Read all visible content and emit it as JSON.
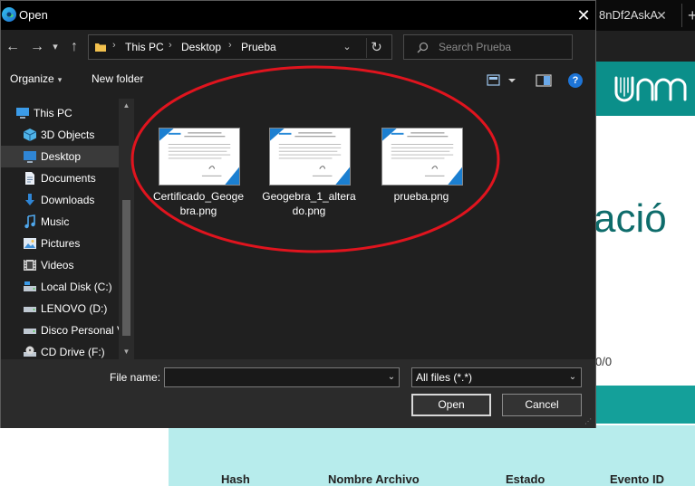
{
  "background": {
    "tab_title": "8nDf2AskA",
    "tab_close": "✕",
    "new_tab": "+",
    "heading_fragment": "ació",
    "pager_text": "0/0",
    "table_headers": [
      "Hash",
      "Nombre Archivo",
      "Estado",
      "Evento ID"
    ],
    "colors": {
      "header_teal": "#0b8f8a",
      "table_bg": "#b7ecec"
    }
  },
  "dialog": {
    "title": "Open",
    "close_glyph": "✕",
    "nav": {
      "back": "←",
      "forward": "→",
      "recent": "▾",
      "up": "↑"
    },
    "breadcrumb": [
      "This PC",
      "Desktop",
      "Prueba"
    ],
    "breadcrumb_sep": "›",
    "address_dropdown": "⌄",
    "refresh": "↻",
    "search_placeholder": "Search Prueba",
    "toolbar": {
      "organize": "Organize",
      "organize_caret": "▾",
      "new_folder": "New folder",
      "help": "?"
    },
    "nav_items": [
      {
        "label": "This PC",
        "icon": "computer-icon"
      },
      {
        "label": "3D Objects",
        "icon": "cube-icon"
      },
      {
        "label": "Desktop",
        "icon": "desktop-icon",
        "selected": true
      },
      {
        "label": "Documents",
        "icon": "document-icon"
      },
      {
        "label": "Downloads",
        "icon": "download-icon"
      },
      {
        "label": "Music",
        "icon": "music-icon"
      },
      {
        "label": "Pictures",
        "icon": "pictures-icon"
      },
      {
        "label": "Videos",
        "icon": "video-icon"
      },
      {
        "label": "Local Disk (C:)",
        "icon": "drive-icon"
      },
      {
        "label": "LENOVO (D:)",
        "icon": "drive-icon"
      },
      {
        "label": "Disco Personal V",
        "icon": "drive-icon"
      },
      {
        "label": "CD Drive (F:)",
        "icon": "cd-drive-icon"
      }
    ],
    "files": [
      {
        "name": "Certificado_Geogebra.png"
      },
      {
        "name": "Geogebra_1_alterado.png"
      },
      {
        "name": "prueba.png"
      }
    ],
    "file_name_label": "File name:",
    "file_name_value": "",
    "filter_value": "All files (*.*)",
    "dropdown_glyph": "⌄",
    "open_button": "Open",
    "cancel_button": "Cancel",
    "annotation_color": "#e0141e"
  }
}
